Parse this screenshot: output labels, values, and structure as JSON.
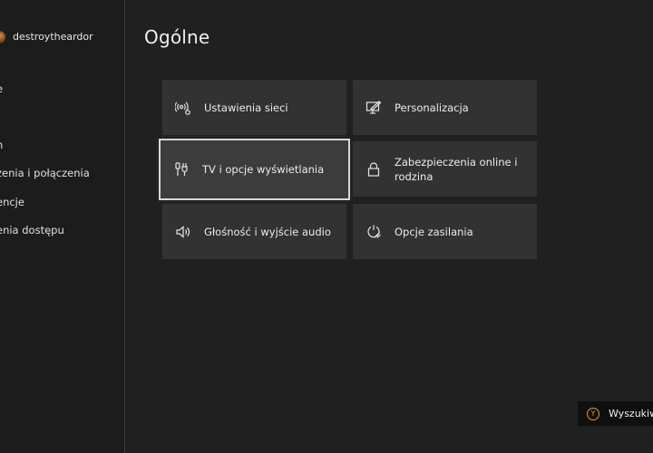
{
  "sidebar": {
    "gamertag": "destroytheardor",
    "items": [
      {
        "label": "e"
      },
      {
        "label": "n"
      },
      {
        "label": "zenia i połączenia"
      },
      {
        "label": "encje"
      },
      {
        "label": "enia dostępu"
      }
    ]
  },
  "main": {
    "title": "Ogólne",
    "tiles": [
      {
        "label": "Ustawienia sieci",
        "icon": "network-icon"
      },
      {
        "label": "Personalizacja",
        "icon": "personalization-icon"
      },
      {
        "label": "TV i opcje wyświetlania",
        "icon": "tv-display-icon"
      },
      {
        "label": "Zabezpieczenia online i rodzina",
        "icon": "lock-icon"
      },
      {
        "label": "Głośność i wyjście audio",
        "icon": "speaker-icon"
      },
      {
        "label": "Opcje zasilania",
        "icon": "power-icon"
      }
    ]
  },
  "hint": {
    "button": "Y",
    "label": "Wyszukiw"
  },
  "colors": {
    "background": "#202020",
    "tile": "#323232",
    "focus_outline": "#d9d9d9",
    "hint_button": "#e0a020"
  }
}
